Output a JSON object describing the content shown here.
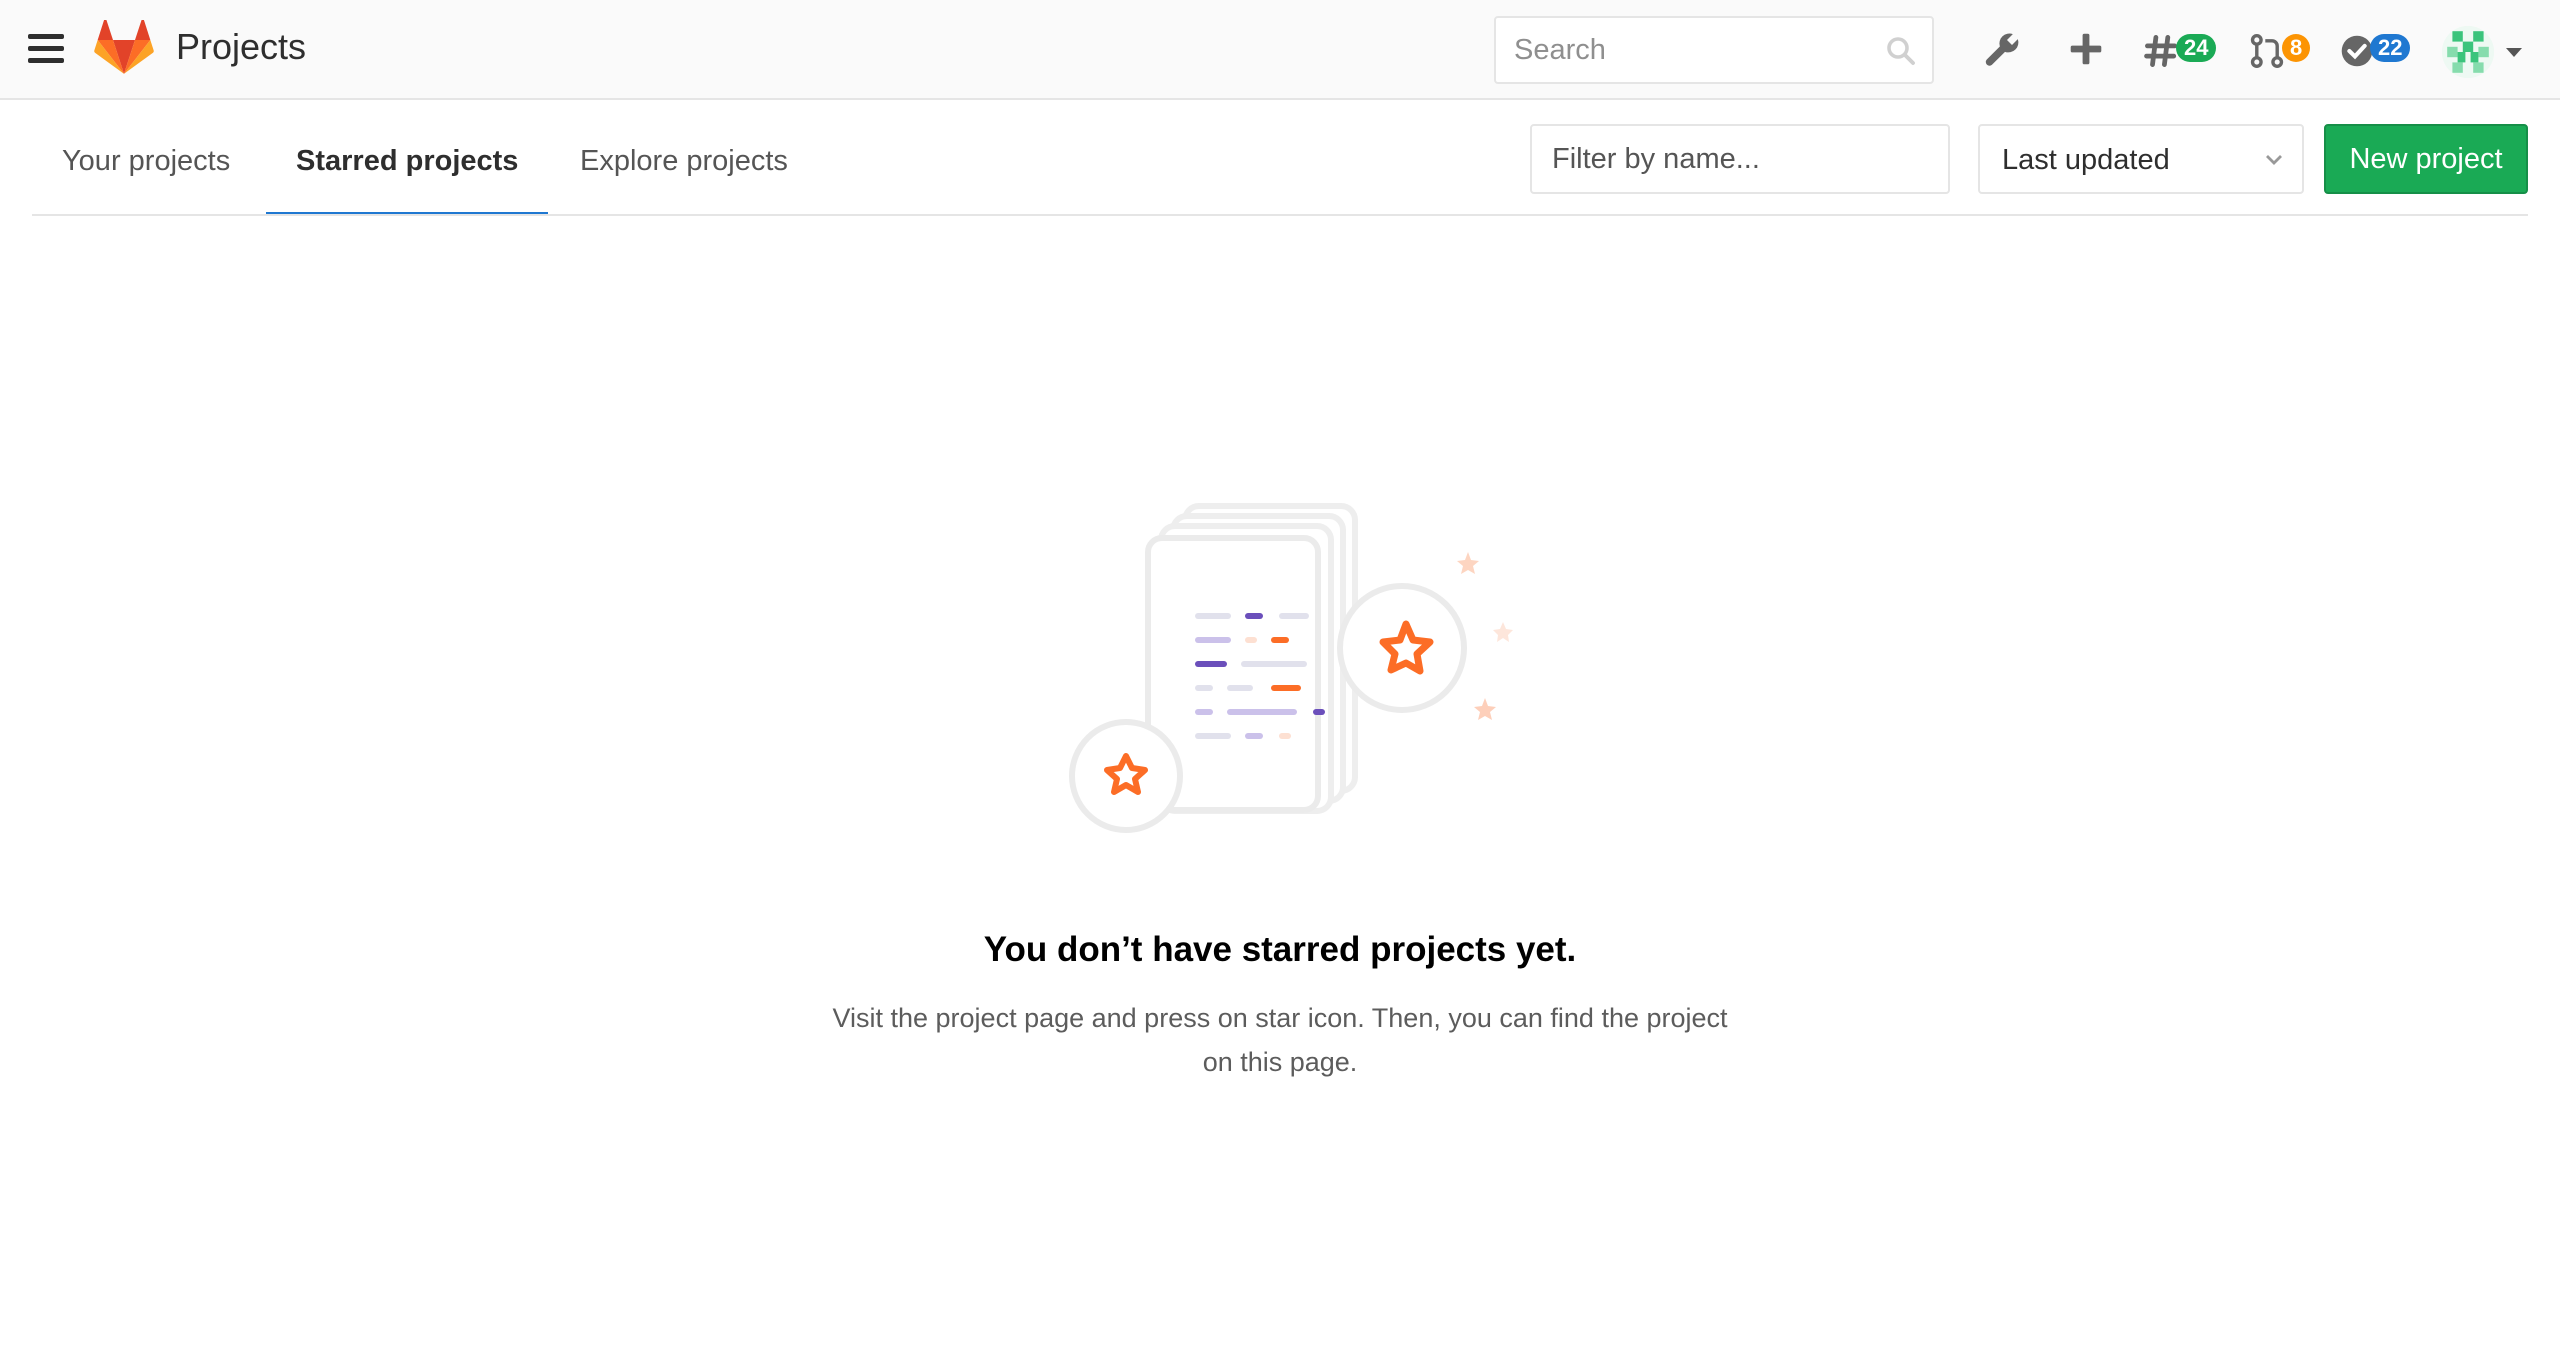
{
  "header": {
    "title": "Projects",
    "search_placeholder": "Search",
    "issues_count": "24",
    "merge_requests_count": "8",
    "todos_count": "22"
  },
  "tabs": [
    {
      "label": "Your projects",
      "active": false
    },
    {
      "label": "Starred projects",
      "active": true
    },
    {
      "label": "Explore projects",
      "active": false
    }
  ],
  "controls": {
    "filter_placeholder": "Filter by name...",
    "sort_selected": "Last updated",
    "new_project_label": "New project"
  },
  "empty_state": {
    "title": "You don’t have starred projects yet.",
    "description": "Visit the project page and press on star icon. Then, you can find the project on this page."
  },
  "colors": {
    "brand_green": "#1aaa55",
    "active_tab_blue": "#1f78d1",
    "mr_orange": "#fc9403",
    "illustration_orange": "#fc6d26",
    "illustration_purple": "#6b4fbb"
  }
}
